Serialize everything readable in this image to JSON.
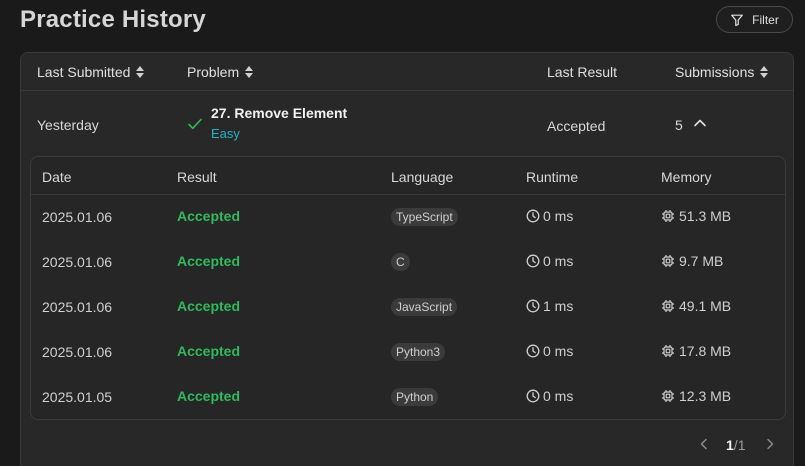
{
  "page": {
    "title": "Practice History"
  },
  "filter": {
    "label": "Filter",
    "icon": "funnel-icon"
  },
  "table": {
    "headers": {
      "last_submitted": "Last Submitted",
      "problem": "Problem",
      "last_result": "Last Result",
      "submissions": "Submissions"
    },
    "row": {
      "last_submitted": "Yesterday",
      "title": "27. Remove Element",
      "difficulty": "Easy",
      "last_result": "Accepted",
      "submissions": "5"
    }
  },
  "details": {
    "headers": {
      "date": "Date",
      "result": "Result",
      "language": "Language",
      "runtime": "Runtime",
      "memory": "Memory"
    },
    "rows": [
      {
        "date": "2025.01.06",
        "result": "Accepted",
        "language": "TypeScript",
        "runtime": "0 ms",
        "memory": "51.3 MB"
      },
      {
        "date": "2025.01.06",
        "result": "Accepted",
        "language": "C",
        "runtime": "0 ms",
        "memory": "9.7 MB"
      },
      {
        "date": "2025.01.06",
        "result": "Accepted",
        "language": "JavaScript",
        "runtime": "1 ms",
        "memory": "49.1 MB"
      },
      {
        "date": "2025.01.06",
        "result": "Accepted",
        "language": "Python3",
        "runtime": "0 ms",
        "memory": "17.8 MB"
      },
      {
        "date": "2025.01.05",
        "result": "Accepted",
        "language": "Python",
        "runtime": "0 ms",
        "memory": "12.3 MB"
      }
    ]
  },
  "pagination": {
    "current": "1",
    "total": "1"
  },
  "colors": {
    "accepted": "#2cbb5d",
    "easy": "#1db5c8",
    "background": "#1a1a1a"
  }
}
